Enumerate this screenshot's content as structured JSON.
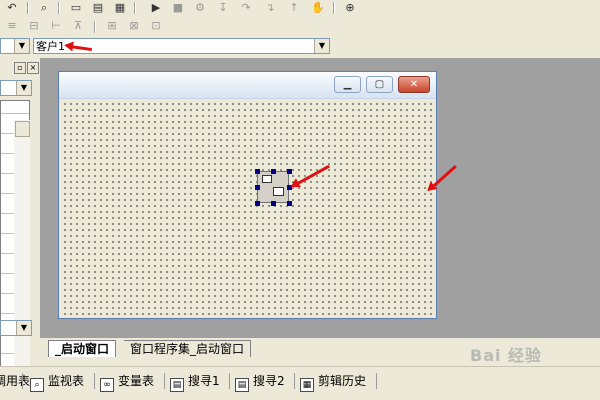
{
  "toolbar_row1": [
    "undo-icon",
    "find-icon",
    "form-view-icon",
    "table-view-icon",
    "code-view-icon",
    "run-icon",
    "stop-icon",
    "debug-icon",
    "step-icon",
    "step-over-icon",
    "step-into-icon",
    "step-out-icon",
    "hand-icon",
    "binoculars-icon"
  ],
  "toolbar_row2": [
    "align-top-icon",
    "align-middle-icon",
    "align-bottom-icon",
    "center-h-icon",
    "same-width-icon",
    "same-height-icon",
    "same-size-icon"
  ],
  "object_combo": {
    "value": "客户1"
  },
  "form": {
    "title": ""
  },
  "tabs": [
    {
      "label": "_启动窗口",
      "active": true
    },
    {
      "label": "窗口程序集_启动窗口",
      "active": false
    }
  ],
  "bottom_bar": [
    {
      "label": "调用表",
      "icon": "call-table-icon"
    },
    {
      "label": "监视表",
      "icon": "monitor-icon"
    },
    {
      "label": "变量表",
      "icon": "variable-icon"
    },
    {
      "label": "搜寻1",
      "icon": "search1-icon"
    },
    {
      "label": "搜寻2",
      "icon": "search2-icon"
    },
    {
      "label": "剪辑历史",
      "icon": "clip-history-icon"
    }
  ],
  "watermark": "Bai 经验"
}
